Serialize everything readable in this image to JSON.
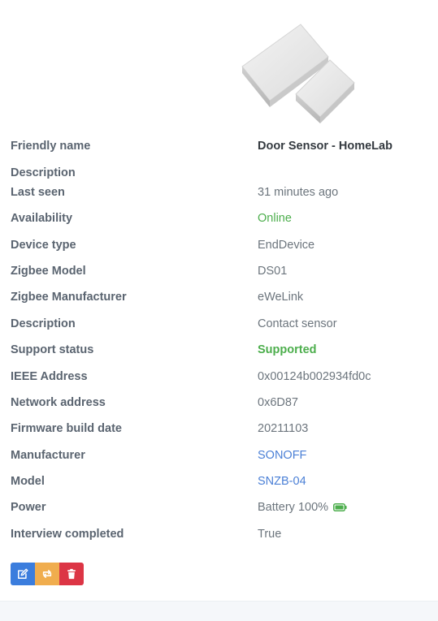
{
  "device": {
    "image_icon": "door-contact-sensor-image"
  },
  "properties": [
    {
      "label": "Friendly name",
      "value": "Door Sensor - HomeLab",
      "style": "strong"
    },
    {
      "label": "Description",
      "value": "",
      "style": ""
    },
    {
      "label": "Last seen",
      "value": "31 minutes ago",
      "style": ""
    },
    {
      "label": "Availability",
      "value": "Online",
      "style": "online"
    },
    {
      "label": "Device type",
      "value": "EndDevice",
      "style": ""
    },
    {
      "label": "Zigbee Model",
      "value": "DS01",
      "style": ""
    },
    {
      "label": "Zigbee Manufacturer",
      "value": "eWeLink",
      "style": ""
    },
    {
      "label": "Description",
      "value": "Contact sensor",
      "style": ""
    },
    {
      "label": "Support status",
      "value": "Supported",
      "style": "supported"
    },
    {
      "label": "IEEE Address",
      "value": "0x00124b002934fd0c",
      "style": ""
    },
    {
      "label": "Network address",
      "value": "0x6D87",
      "style": ""
    },
    {
      "label": "Firmware build date",
      "value": "20211103",
      "style": ""
    },
    {
      "label": "Manufacturer",
      "value": "SONOFF",
      "style": "link"
    },
    {
      "label": "Model",
      "value": "SNZB-04",
      "style": "link"
    },
    {
      "label": "Power",
      "value": "Battery 100%",
      "style": "",
      "icon": "battery-full-icon",
      "battery_level": 1.0
    },
    {
      "label": "Interview completed",
      "value": "True",
      "style": ""
    }
  ],
  "actions": {
    "edit_icon": "edit-icon",
    "reconfigure_icon": "reconfigure-icon",
    "remove_icon": "trash-icon"
  },
  "colors": {
    "online": "#4cae4c",
    "link": "#4a7fd6",
    "edit": "#3b7ddd",
    "reconfigure": "#f0ad4e",
    "remove": "#dc3545",
    "battery": "#4cae4c"
  }
}
